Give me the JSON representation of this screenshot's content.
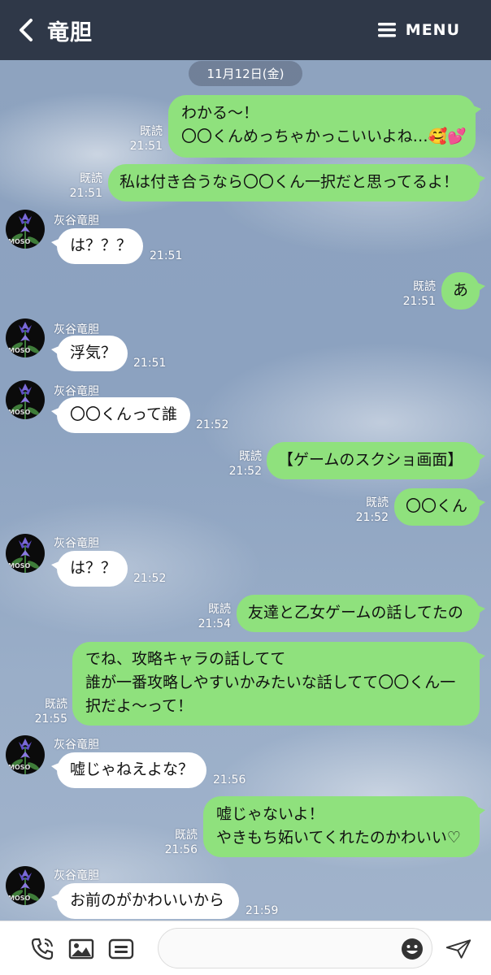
{
  "header": {
    "title": "竜胆",
    "menu_label": "MENU"
  },
  "date_label": "11月12日(金)",
  "read_label": "既読",
  "sender_name": "灰谷竜胆",
  "avatar_text": "MOSO",
  "messages": [
    {
      "from": "me",
      "lines": [
        "わかる〜！",
        "〇〇くんめっちゃかっこいいよね…🥰💕"
      ],
      "read": "既読",
      "time": "21:51"
    },
    {
      "from": "me",
      "lines": [
        "私は付き合うなら〇〇くん一択だと思ってるよ！"
      ],
      "read": "既読",
      "time": "21:51"
    },
    {
      "from": "them",
      "lines": [
        "は？？？"
      ],
      "time": "21:51"
    },
    {
      "from": "me",
      "lines": [
        "あ"
      ],
      "read": "既読",
      "time": "21:51"
    },
    {
      "from": "them",
      "lines": [
        "浮気？"
      ],
      "time": "21:51"
    },
    {
      "from": "them",
      "lines": [
        "〇〇くんって誰"
      ],
      "time": "21:52"
    },
    {
      "from": "me",
      "lines": [
        "【ゲームのスクショ画面】"
      ],
      "read": "既読",
      "time": "21:52"
    },
    {
      "from": "me",
      "lines": [
        "〇〇くん"
      ],
      "read": "既読",
      "time": "21:52"
    },
    {
      "from": "them",
      "lines": [
        "は？？"
      ],
      "time": "21:52"
    },
    {
      "from": "me",
      "lines": [
        "友達と乙女ゲームの話してたの"
      ],
      "read": "既読",
      "time": "21:54"
    },
    {
      "from": "me",
      "lines": [
        "でね、攻略キャラの話してて",
        "誰が一番攻略しやすいかみたいな話してて〇〇くん一",
        "択だよ〜って！"
      ],
      "read": "既読",
      "time": "21:55"
    },
    {
      "from": "them",
      "lines": [
        "嘘じゃねえよな？"
      ],
      "time": "21:56"
    },
    {
      "from": "me",
      "lines": [
        "嘘じゃないよ！",
        "やきもち妬いてくれたのかわいい♡"
      ],
      "read": "既読",
      "time": "21:56"
    },
    {
      "from": "them",
      "lines": [
        "お前のがかわいいから"
      ],
      "time": "21:59"
    }
  ],
  "icons": {
    "back": "chevron-left-icon",
    "menu": "hamburger-icon",
    "call": "phone-icon",
    "image": "image-icon",
    "keyboard": "keyboard-icon",
    "emoji": "smiley-icon",
    "send": "paper-plane-icon"
  },
  "colors": {
    "header": "#2f3848",
    "my_bubble": "#8fe17d",
    "their_bubble": "#ffffff"
  }
}
